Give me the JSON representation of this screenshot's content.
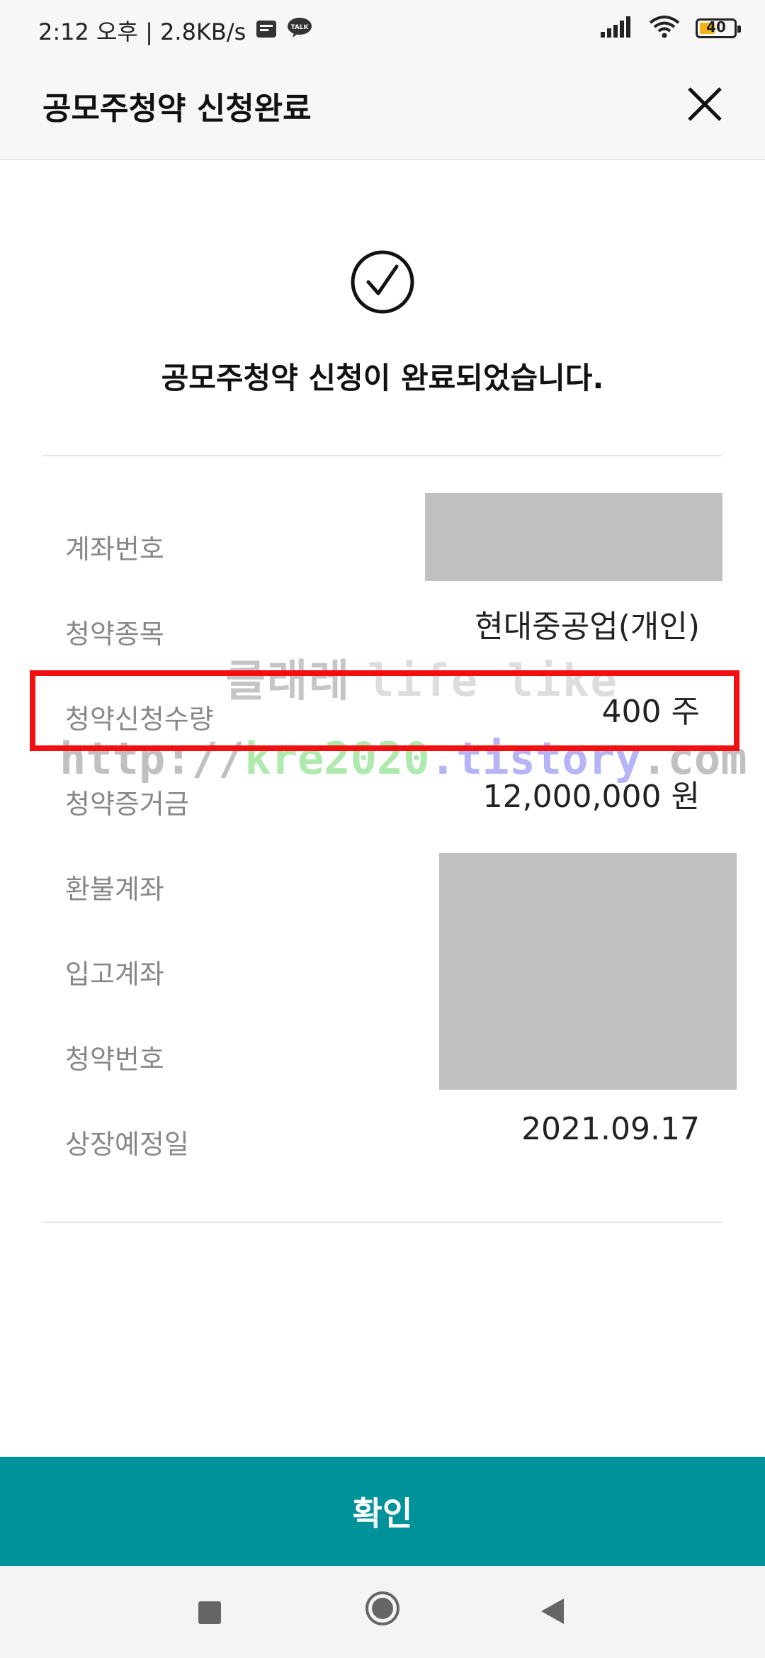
{
  "status_bar": {
    "time": "2:12 오후 | 2.8KB/s",
    "talk_badge": "TALK",
    "battery_level": "40"
  },
  "header": {
    "title": "공모주청약 신청완료"
  },
  "main": {
    "complete_message": "공모주청약 신청이 완료되었습니다.",
    "rows": [
      {
        "label": "계좌번호",
        "value": ""
      },
      {
        "label": "청약종목",
        "value": "현대중공업(개인)"
      },
      {
        "label": "청약신청수량",
        "value": "400 주"
      },
      {
        "label": "청약증거금",
        "value": "12,000,000 원"
      },
      {
        "label": "환불계좌",
        "value": ""
      },
      {
        "label": "입고계좌",
        "value": ""
      },
      {
        "label": "청약번호",
        "value": ""
      },
      {
        "label": "상장예정일",
        "value": "2021.09.17"
      }
    ]
  },
  "watermark": {
    "line1_ko": "클래레",
    "line1_en": "life like",
    "line2_a": "http://",
    "line2_b": "kre2020",
    "line2_c": ".tistory",
    "line2_d": ".com"
  },
  "footer": {
    "confirm_label": "확인"
  },
  "colors": {
    "accent": "#00929a",
    "highlight_border": "#f20f0f",
    "mask": "#c0c0c0"
  },
  "icons": {
    "close": "close-icon",
    "check": "check-circle-icon",
    "nav_recents": "square-icon",
    "nav_home": "circle-icon",
    "nav_back": "triangle-back-icon"
  }
}
